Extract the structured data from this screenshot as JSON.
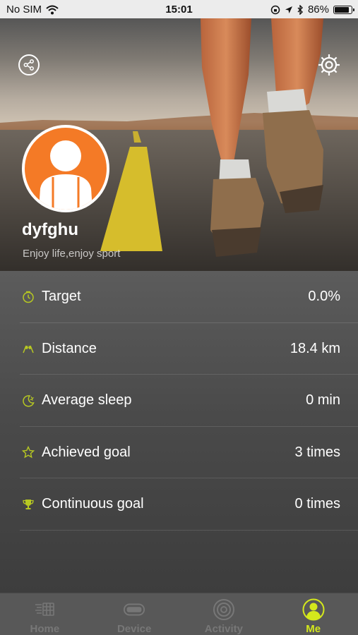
{
  "status_bar": {
    "carrier": "No SIM",
    "time": "15:01",
    "battery_percent": "86%",
    "battery_level": 0.86
  },
  "profile": {
    "username": "dyfghu",
    "motto": "Enjoy life,enjoy sport"
  },
  "stats": [
    {
      "label": "Target",
      "value": "0.0%",
      "icon": "timer-icon"
    },
    {
      "label": "Distance",
      "value": "18.4 km",
      "icon": "flags-icon"
    },
    {
      "label": "Average sleep",
      "value": "0 min",
      "icon": "moon-icon"
    },
    {
      "label": "Achieved goal",
      "value": "3 times",
      "icon": "star-icon"
    },
    {
      "label": "Continuous goal",
      "value": "0 times",
      "icon": "trophy-icon"
    }
  ],
  "tabs": [
    {
      "label": "Home",
      "icon": "home-icon",
      "active": false
    },
    {
      "label": "Device",
      "icon": "device-icon",
      "active": false
    },
    {
      "label": "Activity",
      "icon": "activity-icon",
      "active": false
    },
    {
      "label": "Me",
      "icon": "me-icon",
      "active": true
    }
  ],
  "colors": {
    "accent": "#d4e81c",
    "avatar_bg": "#f47a26"
  }
}
